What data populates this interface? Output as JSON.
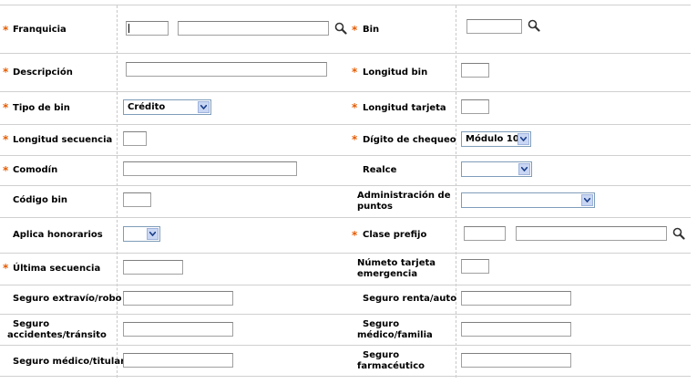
{
  "form": {
    "franquicia_label": "Franquicia",
    "bin_label": "Bin",
    "descripcion_label": "Descripción",
    "longitud_bin_label": "Longitud bin",
    "tipo_bin_label": "Tipo de bin",
    "tipo_bin_value": "Crédito",
    "longitud_tarjeta_label": "Longitud tarjeta",
    "longitud_secuencia_label": "Longitud secuencia",
    "digito_chequeo_label": "Dígito de chequeo",
    "digito_chequeo_value": "Módulo 10",
    "comodin_label": "Comodín",
    "realce_label": "Realce",
    "codigo_bin_label": "Código bin",
    "administracion_puntos_label": "Administración de puntos",
    "aplica_honorarios_label": "Aplica honorarios",
    "clase_prefijo_label": "Clase prefijo",
    "ultima_secuencia_label": "Última secuencia",
    "numeto_tarjeta_emergencia_label": "Númeto tarjeta emergencia",
    "seguro_extravio_label": "Seguro extravío/robo",
    "seguro_renta_label": "Seguro renta/auto",
    "seguro_accidentes_label": "Seguro accidentes/tránsito",
    "seguro_medico_familia_label": "Seguro médico/familia",
    "seguro_medico_titular_label": "Seguro médico/titular",
    "seguro_farmaceutico_label": "Seguro farmacéutico",
    "required_mark": "*"
  },
  "icons": {
    "lookup": "magnifier-icon",
    "dropdown": "chevron-down-icon"
  },
  "colors": {
    "required": "#e65c00",
    "select_arrow": "#c9d6f3",
    "border": "#7f9db9"
  }
}
